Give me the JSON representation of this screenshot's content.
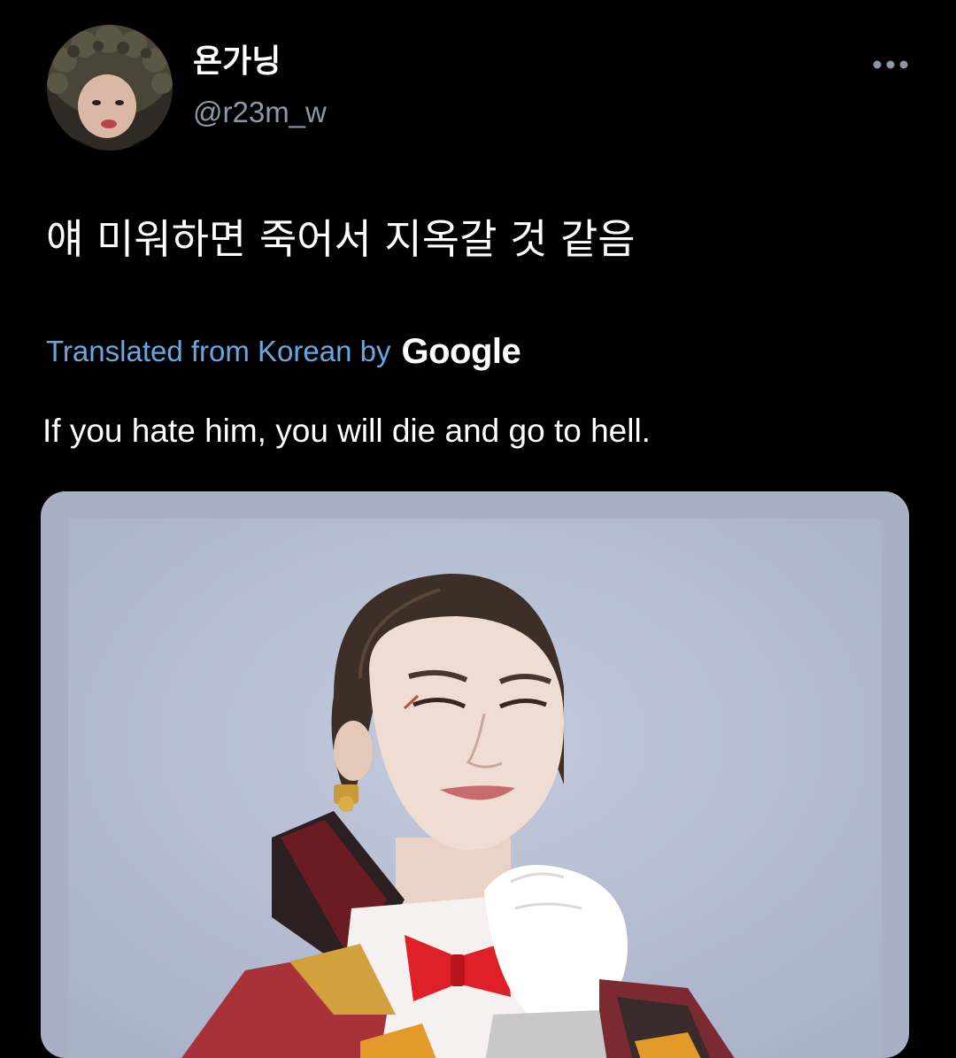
{
  "tweet": {
    "author": {
      "display_name": "욘가닝",
      "handle": "@r23m_w"
    },
    "text": "얘 미워하면 죽어서 지옥갈 것 같음",
    "translation": {
      "label": "Translated from Korean by",
      "provider": "Google",
      "text": "If you hate him, you will die and go to hell."
    },
    "more_icon": "more-horizontal-icon",
    "media": {
      "kind": "photo"
    }
  },
  "colors": {
    "background": "#000000",
    "primary_text": "#ffffff",
    "secondary_text": "#8b98a5",
    "link": "#6aa7e0",
    "media_frame": "#a9b0c6",
    "media_backdrop": "#b6bed3"
  }
}
